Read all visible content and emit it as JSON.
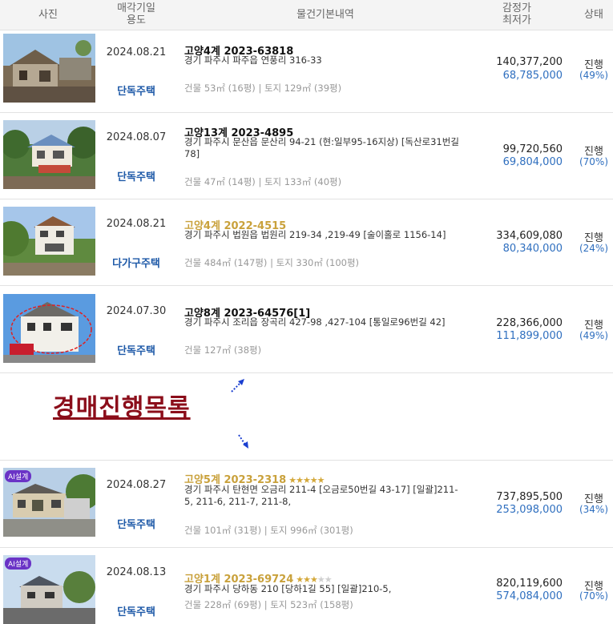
{
  "header": {
    "photo": "사진",
    "date_line1": "매각기일",
    "date_line2": "용도",
    "info": "물건기본내역",
    "price_line1": "감정가",
    "price_line2": "최저가",
    "status": "상태"
  },
  "items": [
    {
      "date": "2024.08.21",
      "usage": "단독주택",
      "case": "고양4계 2023-63818",
      "addr": "경기 파주시 파주읍 연풍리 316-33",
      "area": "건물 53㎡ (16평)  |  토지 129㎡ (39평)",
      "appraised": "140,377,200",
      "minimum": "68,785,000",
      "status": "진행",
      "pct": "(49%)"
    },
    {
      "date": "2024.08.07",
      "usage": "단독주택",
      "case": "고양13계 2023-4895",
      "addr": "경기 파주시 문산읍 문산리 94-21 (현:일부95-16지상) [독산로31번길 78]",
      "area": "건물 47㎡ (14평)  |  토지 133㎡ (40평)",
      "appraised": "99,720,560",
      "minimum": "69,804,000",
      "status": "진행",
      "pct": "(70%)"
    },
    {
      "date": "2024.08.21",
      "usage": "다가구주택",
      "case": "고양4계 2022-4515",
      "addr": "경기 파주시 법원읍 법원리 219-34 ,219-49 [술이홀로 1156-14]",
      "area": "건물 484㎡ (147평)  |  토지 330㎡ (100평)",
      "appraised": "334,609,080",
      "minimum": "80,340,000",
      "status": "진행",
      "pct": "(24%)"
    },
    {
      "date": "2024.07.30",
      "usage": "단독주택",
      "case": "고양8계 2023-64576[1]",
      "addr": "경기 파주시 조리읍 장곡리 427-98 ,427-104 [통일로96번길 42]",
      "area": "건물 127㎡ (38평)",
      "appraised": "228,366,000",
      "minimum": "111,899,000",
      "status": "진행",
      "pct": "(49%)"
    },
    {
      "date": "2024.08.27",
      "usage": "단독주택",
      "case": "고양5계 2023-2318",
      "stars_on": "★★★★★",
      "stars_off": "",
      "addr": "경기 파주시 탄현면 오금리 211-4 [오금로50번길 43-17]  [일괄]211-5, 211-6, 211-7, 211-8,",
      "area": "건물 101㎡ (31평)  |  토지 996㎡ (301평)",
      "appraised": "737,895,500",
      "minimum": "253,098,000",
      "status": "진행",
      "pct": "(34%)",
      "badge": "AI설계"
    },
    {
      "date": "2024.08.13",
      "usage": "단독주택",
      "case": "고양1계 2023-69724",
      "stars_on": "★★★",
      "stars_off": "★★",
      "addr": "경기 파주시 당하동 210 [당하1길 55]  [일괄]210-5,",
      "area": "건물 228㎡ (69평)  |  토지 523㎡ (158평)",
      "appraised": "820,119,600",
      "minimum": "574,084,000",
      "status": "진행",
      "pct": "(70%)",
      "badge": "AI설계"
    }
  ],
  "banner": {
    "text": "경매진행목록"
  },
  "colors": {
    "header_bg": "#f4f4f4",
    "usage": "#1f5aa8",
    "minimum_price": "#2f6fbf",
    "gold_case": "#c9a13b",
    "banner": "#8b0d1a",
    "badge": "#6a33c6"
  }
}
